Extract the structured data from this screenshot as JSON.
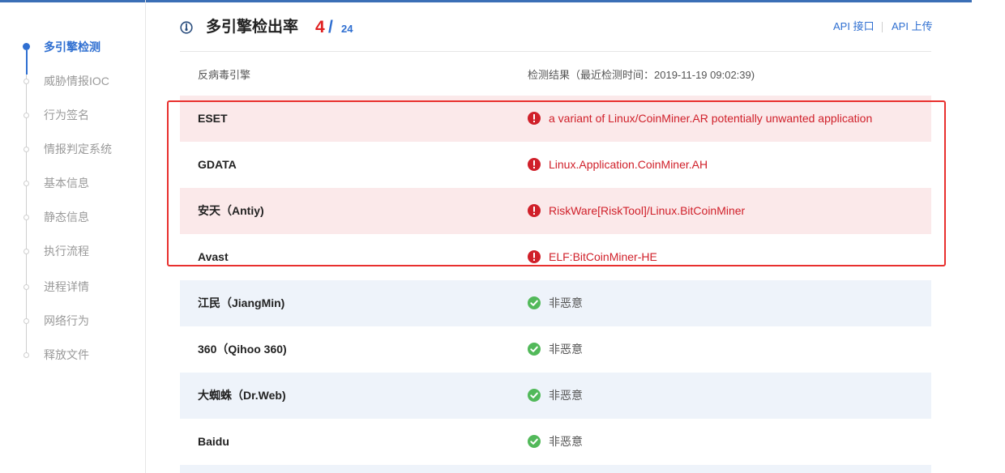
{
  "sidebar": {
    "items": [
      {
        "label": "多引擎检测",
        "active": true
      },
      {
        "label": "威胁情报IOC",
        "active": false
      },
      {
        "label": "行为签名",
        "active": false
      },
      {
        "label": "情报判定系统",
        "active": false
      },
      {
        "label": "基本信息",
        "active": false
      },
      {
        "label": "静态信息",
        "active": false
      },
      {
        "label": "执行流程",
        "active": false
      },
      {
        "label": "进程详情",
        "active": false
      },
      {
        "label": "网络行为",
        "active": false
      },
      {
        "label": "释放文件",
        "active": false
      }
    ]
  },
  "header": {
    "icon": "gauge-icon",
    "title": "多引擎检出率",
    "detected": "4",
    "slash": "/",
    "total": "24",
    "api_link": "API 接口",
    "api_upload": "API 上传"
  },
  "table": {
    "col_engine": "反病毒引擎",
    "col_result": "检测结果（最近检测时间：2019-11-19 09:02:39)",
    "rows": [
      {
        "engine": "ESET",
        "result": "a variant of Linux/CoinMiner.AR potentially unwanted application",
        "status": "malicious"
      },
      {
        "engine": "GDATA",
        "result": "Linux.Application.CoinMiner.AH",
        "status": "malicious"
      },
      {
        "engine": "安天（Antiy)",
        "result": "RiskWare[RiskTool]/Linux.BitCoinMiner",
        "status": "malicious"
      },
      {
        "engine": "Avast",
        "result": "ELF:BitCoinMiner-HE",
        "status": "malicious"
      },
      {
        "engine": "江民（JiangMin)",
        "result": "非恶意",
        "status": "clean"
      },
      {
        "engine": "360（Qihoo 360)",
        "result": "非恶意",
        "status": "clean"
      },
      {
        "engine": "大蜘蛛（Dr.Web)",
        "result": "非恶意",
        "status": "clean"
      },
      {
        "engine": "Baidu",
        "result": "非恶意",
        "status": "clean"
      }
    ]
  },
  "colors": {
    "accent": "#2f6fd1",
    "malicious": "#d0202a",
    "clean": "#52b95a",
    "annotation": "#e8302e"
  }
}
